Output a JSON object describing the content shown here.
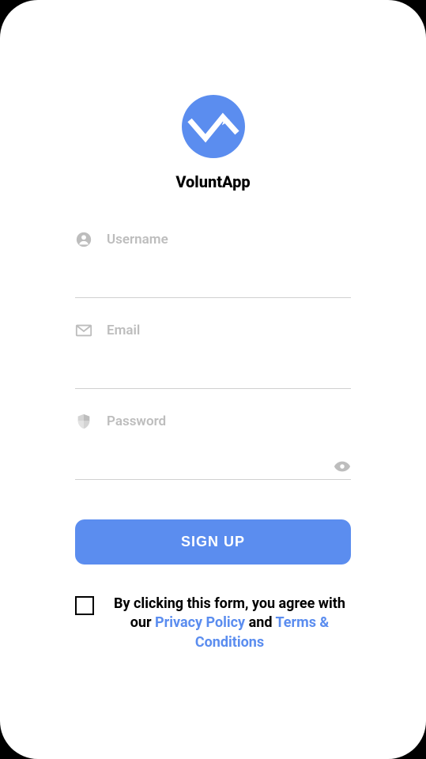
{
  "brand": {
    "name": "VoluntApp",
    "accent": "#5b8def"
  },
  "form": {
    "username": {
      "label": "Username",
      "value": ""
    },
    "email": {
      "label": "Email",
      "value": ""
    },
    "password": {
      "label": "Password",
      "value": ""
    },
    "submit": "SIGN UP"
  },
  "consent": {
    "text_before": "By clicking this form, you agree with our ",
    "privacy_link": "Privacy Policy",
    "text_middle": " and ",
    "terms_link": "Terms & Conditions",
    "checked": false
  }
}
